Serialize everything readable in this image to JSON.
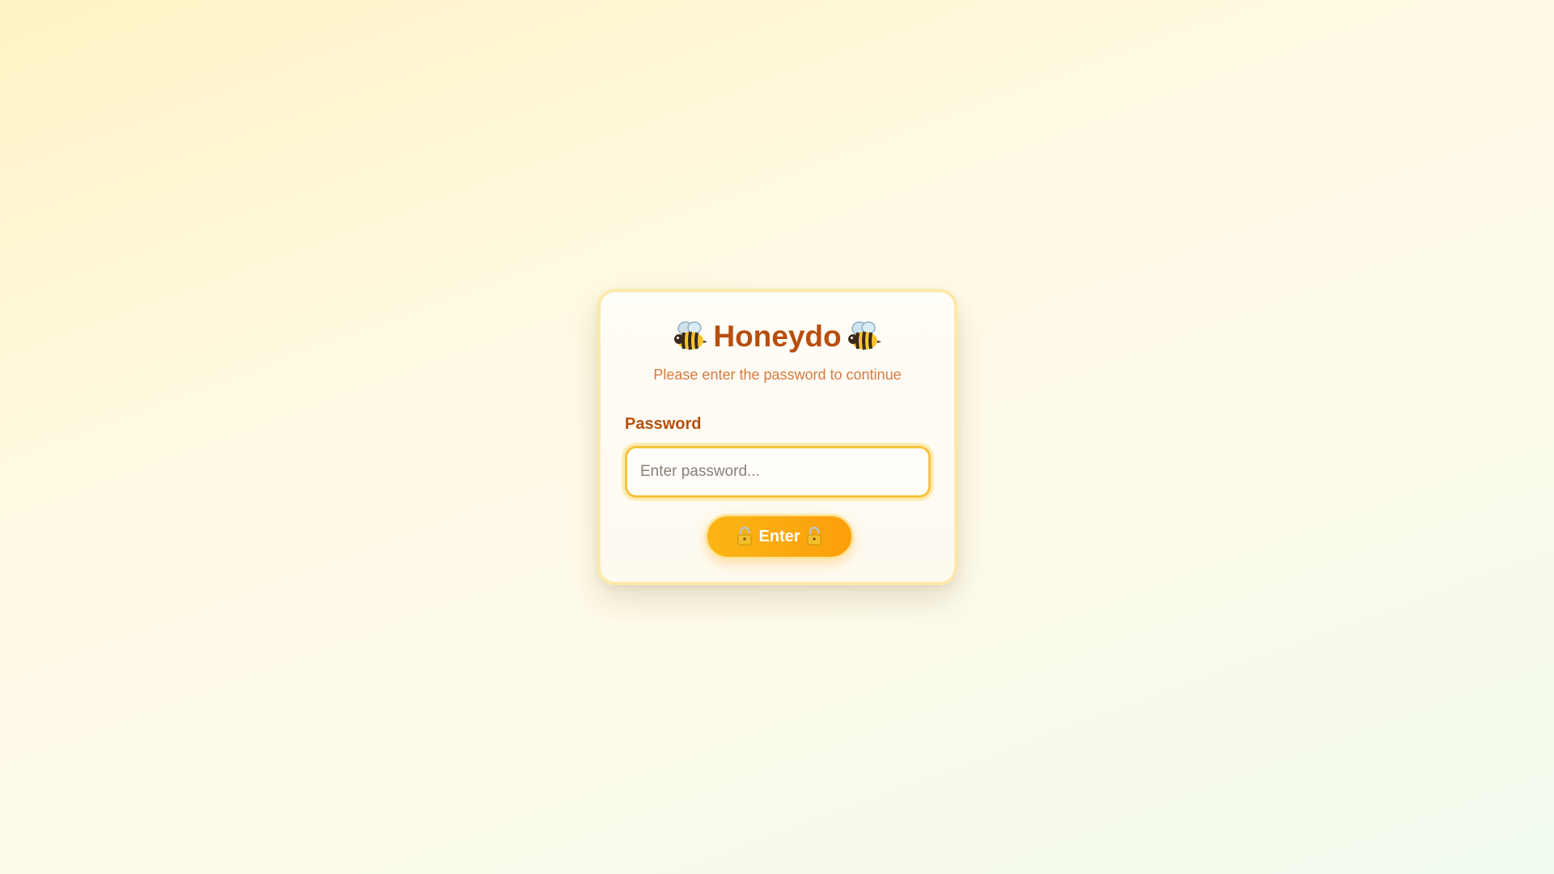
{
  "login": {
    "title": "Honeydo",
    "subtitle": "Please enter the password to continue",
    "password_label": "Password",
    "password_placeholder": "Enter password...",
    "password_value": "",
    "submit_label": "Enter"
  },
  "icons": {
    "title_left": "bee-icon",
    "title_right": "bee-icon",
    "button_left": "lock-icon",
    "button_right": "lock-icon"
  },
  "colors": {
    "brand_text": "#b84e0c",
    "subtitle_text": "#d57a40",
    "button_start": "#fbb515",
    "button_end": "#fb9e0a",
    "input_border": "#f8c23a"
  }
}
